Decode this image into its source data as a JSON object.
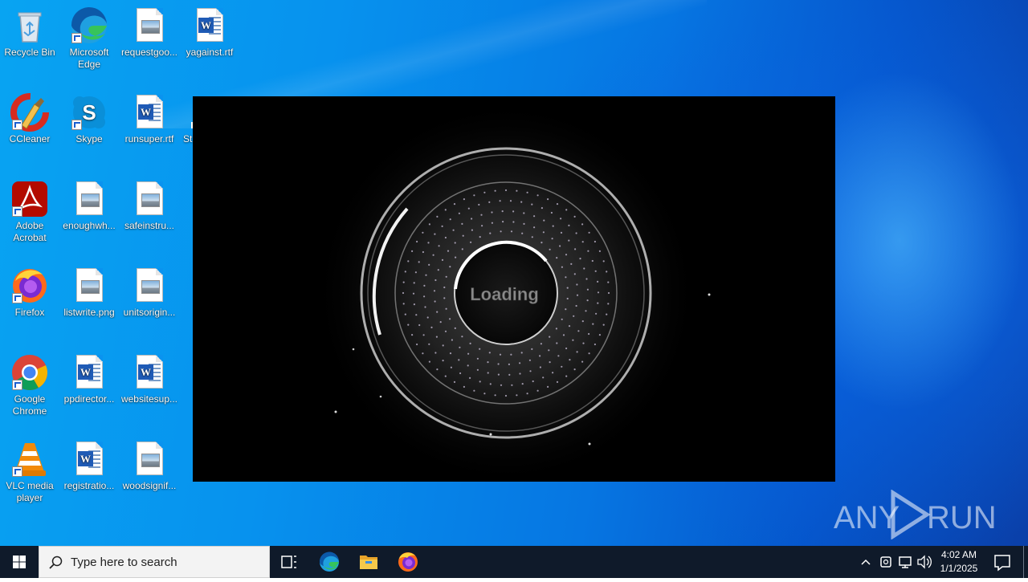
{
  "desktop_icons": [
    {
      "label": "Recycle Bin",
      "icon": "recycle-bin-icon"
    },
    {
      "label": "Microsoft Edge",
      "icon": "edge-icon"
    },
    {
      "label": "requestgoo...",
      "icon": "image-file-icon"
    },
    {
      "label": "yagainst.rtf",
      "icon": "word-document-icon"
    },
    {
      "label": "CCleaner",
      "icon": "ccleaner-icon"
    },
    {
      "label": "Skype",
      "icon": "skype-icon"
    },
    {
      "label": "runsuper.rtf",
      "icon": "word-document-icon"
    },
    {
      "label": "St",
      "icon": "partial-icon"
    },
    {
      "label": "Adobe Acrobat",
      "icon": "acrobat-icon"
    },
    {
      "label": "enoughwh...",
      "icon": "image-file-icon"
    },
    {
      "label": "safeinstru...",
      "icon": "image-file-icon"
    },
    {
      "label": "Firefox",
      "icon": "firefox-icon"
    },
    {
      "label": "listwrite.png",
      "icon": "image-file-icon"
    },
    {
      "label": "unitsorigin...",
      "icon": "image-file-icon"
    },
    {
      "label": "Google Chrome",
      "icon": "chrome-icon"
    },
    {
      "label": "ppdirector...",
      "icon": "word-document-icon"
    },
    {
      "label": "websitesup...",
      "icon": "word-document-icon"
    },
    {
      "label": "VLC media player",
      "icon": "vlc-icon"
    },
    {
      "label": "registratio...",
      "icon": "word-document-icon"
    },
    {
      "label": "woodsignif...",
      "icon": "image-file-icon"
    }
  ],
  "loader": {
    "text": "Loading"
  },
  "watermark": {
    "text_left": "ANY",
    "text_right": "RUN"
  },
  "taskbar": {
    "search_placeholder": "Type here to search",
    "time": "4:02 AM",
    "date": "1/1/2025",
    "pinned": [
      "task-view-icon",
      "edge-icon",
      "file-explorer-icon",
      "firefox-icon"
    ],
    "tray": [
      "chevron-up-icon",
      "meet-now-icon",
      "network-icon",
      "volume-icon",
      "notification-icon"
    ]
  }
}
